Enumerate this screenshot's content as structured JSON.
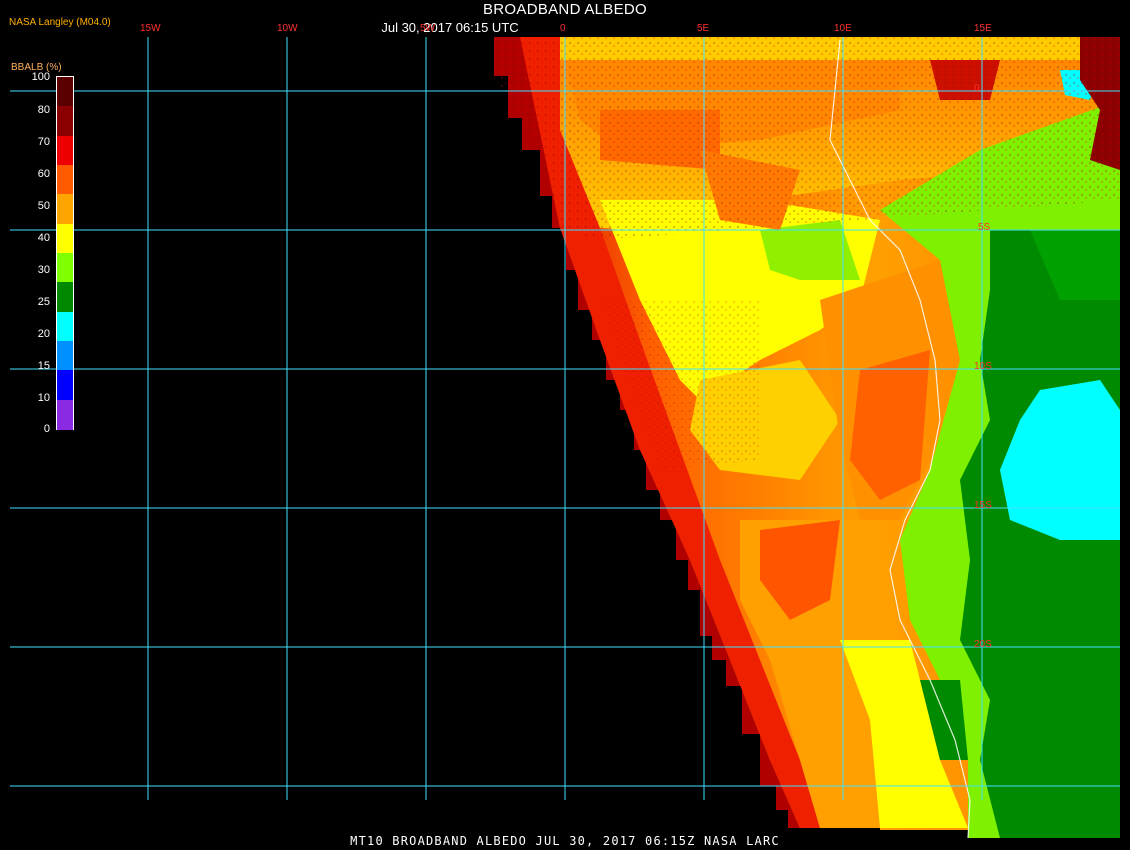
{
  "header": {
    "title": "BROADBAND ALBEDO",
    "subtitle": "Jul 30, 2017 06:15 UTC",
    "source": "NASA Langley (M04.0)"
  },
  "colorbar": {
    "title": "BBALB (%)",
    "ticks": [
      "100",
      "80",
      "70",
      "60",
      "50",
      "40",
      "30",
      "25",
      "20",
      "15",
      "10",
      "0"
    ],
    "colors": [
      "#5a0000",
      "#8b0000",
      "#ee0000",
      "#ff5a00",
      "#ffa500",
      "#ffff00",
      "#80ff00",
      "#008800",
      "#00ffff",
      "#0090ff",
      "#0000ff",
      "#8a2be2"
    ]
  },
  "grid": {
    "lon_labels": [
      "15W",
      "10W",
      "5W",
      "0",
      "5E",
      "10E",
      "15E"
    ],
    "lat_labels": [
      "0",
      "5S",
      "10S",
      "15S",
      "20S"
    ],
    "color": "#40e0ff"
  },
  "footer": {
    "text": "MT10  BROADBAND ALBEDO   JUL 30, 2017 06:15Z   NASA LARC"
  },
  "colors": {
    "background": "#000000",
    "title": "#ffffff",
    "source": "#ffb000",
    "grid_label": "#ff3030"
  }
}
